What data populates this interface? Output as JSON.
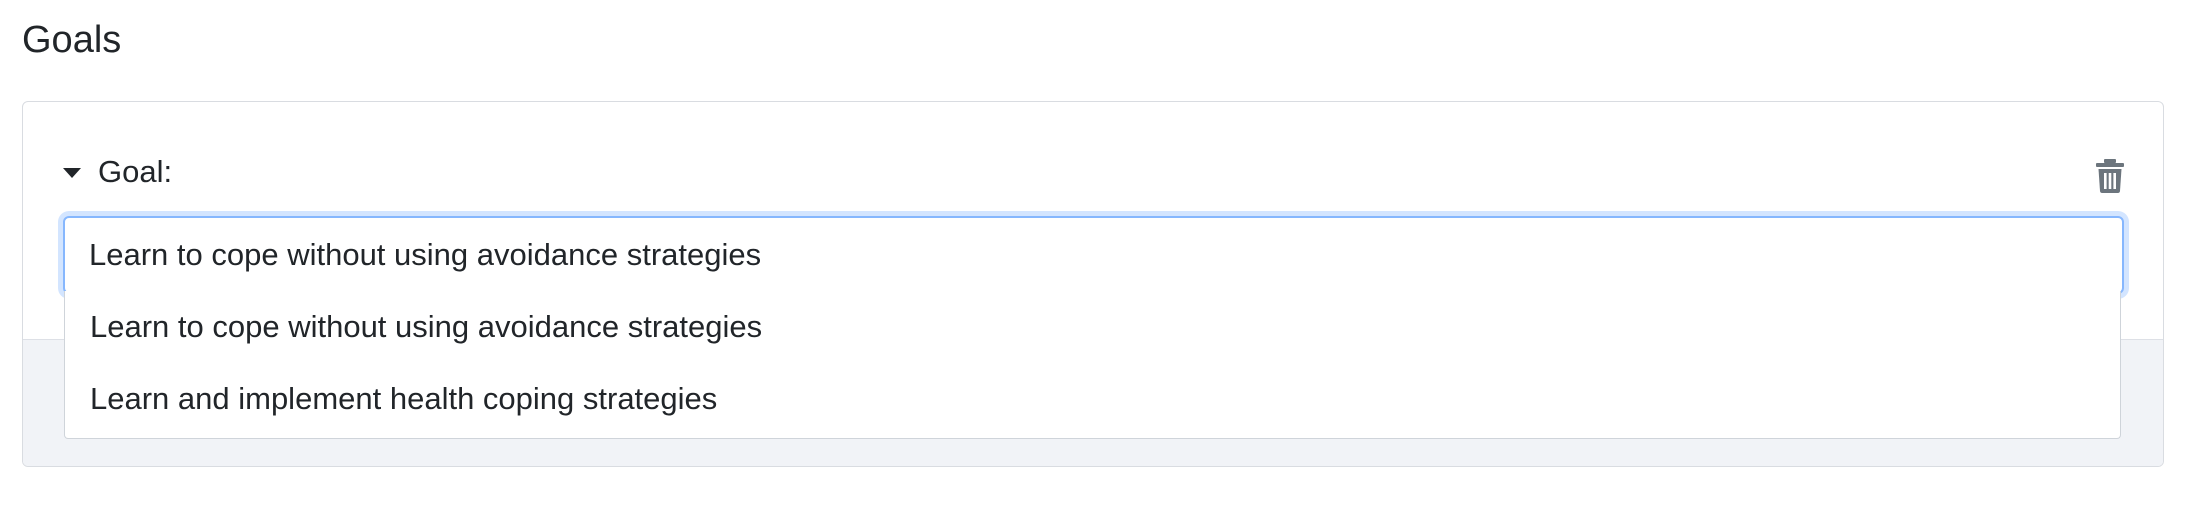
{
  "page": {
    "title": "Goals"
  },
  "goal": {
    "label": "Goal:",
    "input_value": "Learn to cope without using avoidance strategies",
    "delete_icon": "trash-icon",
    "toggle_icon": "caret-down-icon"
  },
  "suggestions": [
    {
      "label": "Learn to cope without using avoidance strategies"
    },
    {
      "label": "Learn and implement health coping strategies"
    }
  ],
  "colors": {
    "focus_border": "#86b7fe",
    "footer_bg": "#f1f3f7",
    "icon_gray": "#6c757d"
  }
}
